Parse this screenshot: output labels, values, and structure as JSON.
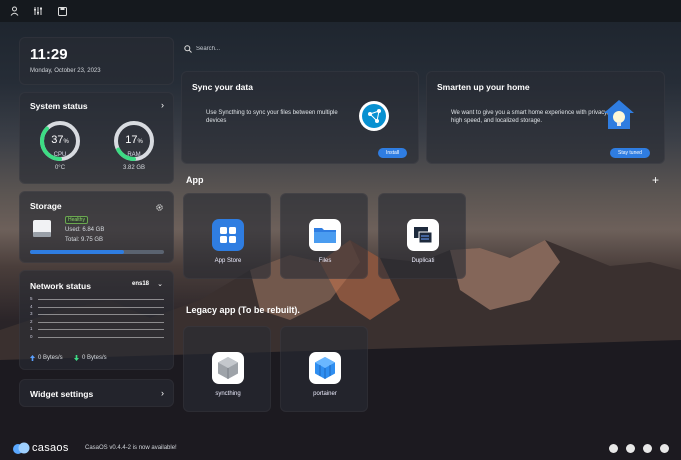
{
  "topbar": {
    "icons": [
      "user-icon",
      "sliders-icon",
      "save-icon"
    ]
  },
  "clock": {
    "time": "11:29",
    "date": "Monday, October 23, 2023"
  },
  "system_status": {
    "title": "System status",
    "cpu": {
      "value": "37",
      "unit": "%",
      "label": "CPU",
      "sub": "0°C",
      "percent": 37,
      "color": "#3ddc84"
    },
    "ram": {
      "value": "17",
      "unit": "%",
      "label": "RAM",
      "sub": "3.82 GB",
      "percent": 17,
      "color": "#3ddc84"
    }
  },
  "storage": {
    "title": "Storage",
    "badge": "Healthy",
    "used": "Used: 6.84 GB",
    "total": "Total: 9.75 GB",
    "percent": 70,
    "color": "#2f7de1"
  },
  "network": {
    "title": "Network status",
    "interface": "ens18",
    "axis": [
      "5",
      "4",
      "3",
      "2",
      "1",
      "0"
    ],
    "upload": "0 Bytes/s",
    "download": "0 Bytes/s"
  },
  "widget_settings": {
    "title": "Widget settings"
  },
  "search": {
    "placeholder": "Search..."
  },
  "sync_card": {
    "title": "Sync your data",
    "description": "Use Syncthing to sync your files between multiple devices",
    "button": "Install"
  },
  "home_card": {
    "title": "Smarten up your home",
    "description": "We want to give you a smart home experience with privacy, high speed, and localized storage.",
    "button": "Stay tuned"
  },
  "apps": {
    "title": "App",
    "items": [
      {
        "name": "App Store",
        "icon": "app-store-icon"
      },
      {
        "name": "Files",
        "icon": "folder-icon"
      },
      {
        "name": "Duplicati",
        "icon": "duplicati-icon"
      }
    ]
  },
  "legacy": {
    "title": "Legacy app (To be rebuilt).",
    "items": [
      {
        "name": "syncthing",
        "icon": "syncthing-icon"
      },
      {
        "name": "portainer",
        "icon": "portainer-icon"
      }
    ]
  },
  "footer": {
    "logo": "casaos",
    "version_text": "CasaOS v0.4.4-2 is now available!"
  }
}
